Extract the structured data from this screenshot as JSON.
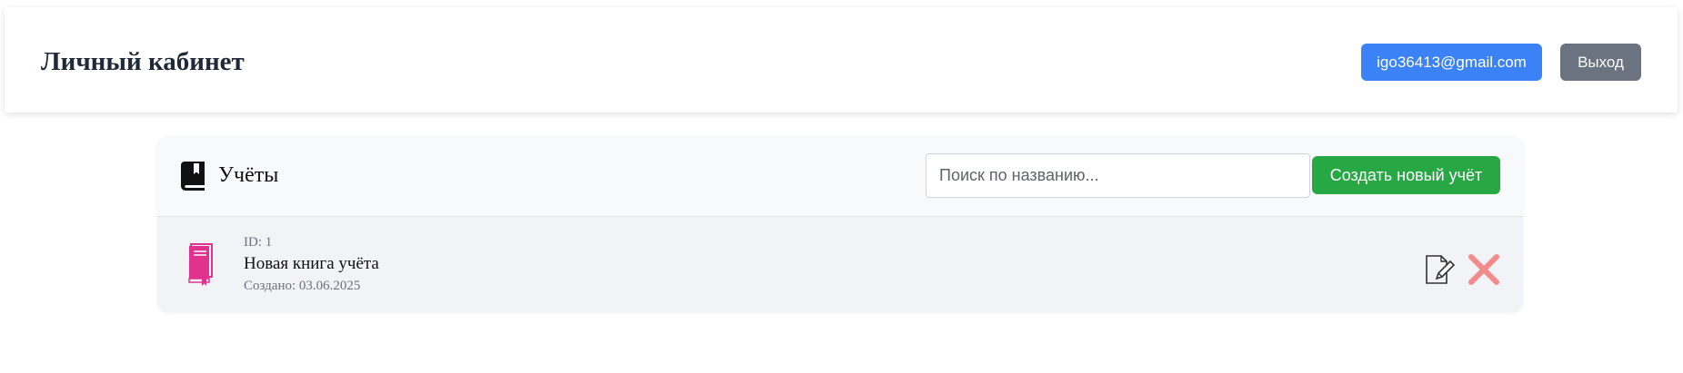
{
  "header": {
    "title": "Личный кабинет",
    "user_email": "igo36413@gmail.com",
    "logout_label": "Выход"
  },
  "ledgers_panel": {
    "title": "Учёты",
    "icon": "book-icon",
    "search": {
      "placeholder": "Поиск по названию...",
      "value": ""
    },
    "create_label": "Создать новый учёт",
    "items": [
      {
        "id_text": "ID: 1",
        "name": "Новая книга учёта",
        "created_text": "Создано: 03.06.2025",
        "icon": "ledger-book-icon",
        "actions": [
          "edit-icon",
          "delete-icon"
        ]
      }
    ]
  },
  "colors": {
    "primary": "#3b82f6",
    "secondary": "#6b7280",
    "success": "#28a745",
    "ledger_icon": "#e0338f",
    "delete": "#f28b8b"
  }
}
